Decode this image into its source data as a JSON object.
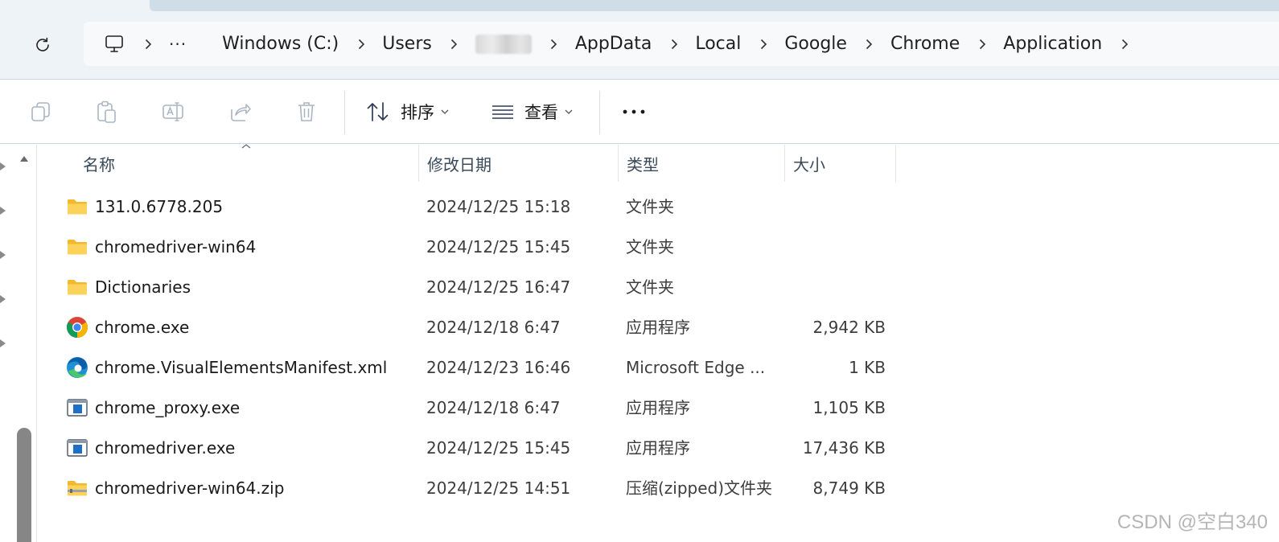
{
  "breadcrumb": {
    "overflow": "···",
    "items": [
      "Windows (C:)",
      "Users",
      "",
      "AppData",
      "Local",
      "Google",
      "Chrome",
      "Application"
    ]
  },
  "toolbar": {
    "sort_label": "排序",
    "view_label": "查看",
    "more_label": "···"
  },
  "columns": {
    "name": "名称",
    "date": "修改日期",
    "type": "类型",
    "size": "大小"
  },
  "files": [
    {
      "name": "131.0.6778.205",
      "date": "2024/12/25 15:18",
      "type": "文件夹",
      "size": "",
      "icon": "folder-icon"
    },
    {
      "name": "chromedriver-win64",
      "date": "2024/12/25 15:45",
      "type": "文件夹",
      "size": "",
      "icon": "folder-icon"
    },
    {
      "name": "Dictionaries",
      "date": "2024/12/25 16:47",
      "type": "文件夹",
      "size": "",
      "icon": "folder-icon"
    },
    {
      "name": "chrome.exe",
      "date": "2024/12/18 6:47",
      "type": "应用程序",
      "size": "2,942 KB",
      "icon": "chrome-icon"
    },
    {
      "name": "chrome.VisualElementsManifest.xml",
      "date": "2024/12/23 16:46",
      "type": "Microsoft Edge ...",
      "size": "1 KB",
      "icon": "edge-icon"
    },
    {
      "name": "chrome_proxy.exe",
      "date": "2024/12/18 6:47",
      "type": "应用程序",
      "size": "1,105 KB",
      "icon": "exe-icon"
    },
    {
      "name": "chromedriver.exe",
      "date": "2024/12/25 15:45",
      "type": "应用程序",
      "size": "17,436 KB",
      "icon": "exe-icon"
    },
    {
      "name": "chromedriver-win64.zip",
      "date": "2024/12/25 14:51",
      "type": "压缩(zipped)文件夹",
      "size": "8,749 KB",
      "icon": "zip-folder-icon"
    }
  ],
  "watermark": "CSDN @空白340",
  "colors": {
    "header_bg": "#eef3f8",
    "folder_yellow": "#f8c94a",
    "scroll_thumb": "#868686"
  }
}
